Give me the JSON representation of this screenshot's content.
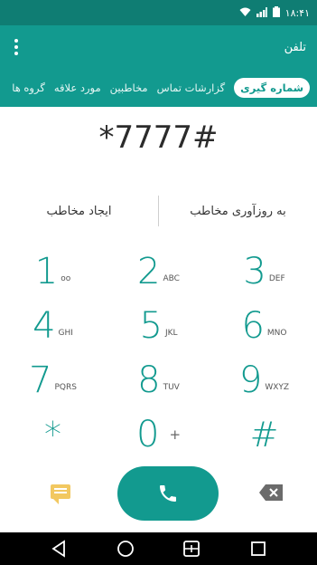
{
  "status_bar": {
    "time": "۱۸:۴۱",
    "icons": [
      "wifi-icon",
      "signal-icon",
      "battery-icon"
    ]
  },
  "app_bar": {
    "title": "تلفن",
    "menu_icon": "overflow-menu-icon"
  },
  "tabs": [
    {
      "label": "شماره گیری",
      "active": true
    },
    {
      "label": "گزارشات تماس",
      "active": false
    },
    {
      "label": "مخاطبین",
      "active": false
    },
    {
      "label": "مورد علاقه",
      "active": false
    },
    {
      "label": "گروه ها",
      "active": false
    }
  ],
  "dialed_number": "*7777#",
  "contact_actions": {
    "update_contact": "به روزآوری مخاطب",
    "create_contact": "ایجاد مخاطب"
  },
  "keypad": [
    [
      {
        "digit": "1",
        "letters": "ᴏᴏ"
      },
      {
        "digit": "2",
        "letters": "ABC"
      },
      {
        "digit": "3",
        "letters": "DEF"
      }
    ],
    [
      {
        "digit": "4",
        "letters": "GHI"
      },
      {
        "digit": "5",
        "letters": "JKL"
      },
      {
        "digit": "6",
        "letters": "MNO"
      }
    ],
    [
      {
        "digit": "7",
        "letters": "PQRS"
      },
      {
        "digit": "8",
        "letters": "TUV"
      },
      {
        "digit": "9",
        "letters": "WXYZ"
      }
    ],
    [
      {
        "digit": "*",
        "letters": ""
      },
      {
        "digit": "0",
        "letters": "+"
      },
      {
        "digit": "#",
        "letters": ""
      }
    ]
  ],
  "bottom_actions": {
    "message_icon": "message-icon",
    "call_icon": "phone-icon",
    "delete_icon": "backspace-icon"
  },
  "navigation": [
    "back-icon",
    "home-icon",
    "dual-window-icon",
    "recent-apps-icon"
  ],
  "colors": {
    "accent": "#129a8f",
    "status_bar": "#0f7d73",
    "message_icon": "#f2c860",
    "nav_bar": "#000000"
  }
}
